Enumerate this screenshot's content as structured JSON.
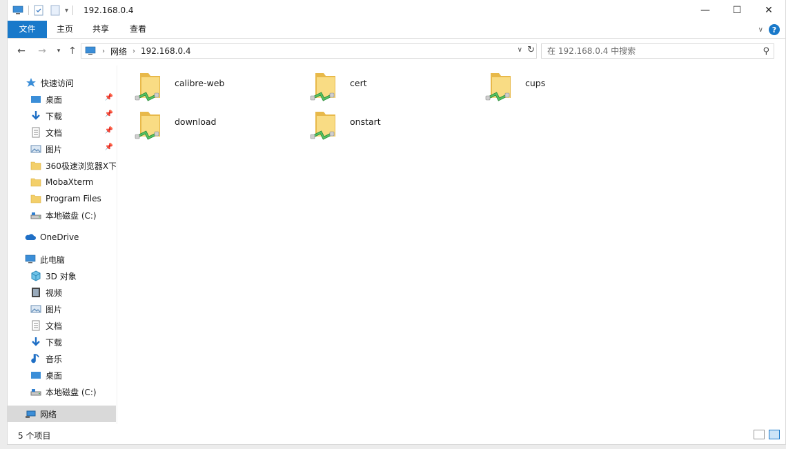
{
  "window": {
    "title": "192.168.0.4",
    "controls": {
      "minimize": "—",
      "maximize": "☐",
      "close": "✕"
    }
  },
  "ribbon": {
    "tabs": [
      {
        "label": "文件",
        "active": true
      },
      {
        "label": "主页"
      },
      {
        "label": "共享"
      },
      {
        "label": "查看"
      }
    ],
    "help_label": "?"
  },
  "address": {
    "crumbs": [
      "网络",
      "192.168.0.4"
    ]
  },
  "search": {
    "placeholder": "在 192.168.0.4 中搜索"
  },
  "navpane": {
    "items": [
      {
        "label": "快速访问",
        "icon": "star-icon"
      },
      {
        "label": "桌面",
        "icon": "desktop-icon",
        "pinned": true
      },
      {
        "label": "下载",
        "icon": "download-icon",
        "pinned": true
      },
      {
        "label": "文档",
        "icon": "document-icon",
        "pinned": true
      },
      {
        "label": "图片",
        "icon": "pictures-icon",
        "pinned": true
      },
      {
        "label": "360极速浏览器X下载",
        "icon": "folder-icon"
      },
      {
        "label": "MobaXterm",
        "icon": "folder-icon"
      },
      {
        "label": "Program Files",
        "icon": "folder-icon"
      },
      {
        "label": "本地磁盘 (C:)",
        "icon": "drive-icon"
      },
      {
        "label": "OneDrive",
        "icon": "cloud-icon"
      },
      {
        "label": "此电脑",
        "icon": "pc-icon"
      },
      {
        "label": "3D 对象",
        "icon": "cube-icon"
      },
      {
        "label": "视频",
        "icon": "video-icon"
      },
      {
        "label": "图片",
        "icon": "pictures-icon"
      },
      {
        "label": "文档",
        "icon": "document-icon"
      },
      {
        "label": "下载",
        "icon": "download-icon"
      },
      {
        "label": "音乐",
        "icon": "music-icon"
      },
      {
        "label": "桌面",
        "icon": "desktop-icon"
      },
      {
        "label": "本地磁盘 (C:)",
        "icon": "drive-icon"
      },
      {
        "label": "网络",
        "icon": "network-icon",
        "selected": true
      }
    ]
  },
  "content": {
    "items": [
      {
        "name": "calibre-web",
        "icon": "shared-folder-icon"
      },
      {
        "name": "cert",
        "icon": "shared-folder-icon"
      },
      {
        "name": "cups",
        "icon": "shared-folder-icon"
      },
      {
        "name": "download",
        "icon": "shared-folder-icon"
      },
      {
        "name": "onstart",
        "icon": "shared-folder-icon"
      }
    ]
  },
  "status": {
    "text": "5 个项目"
  },
  "colors": {
    "accent": "#1979ca",
    "folder": "#f3cf6a",
    "share_green": "#3aa84a",
    "selected_bg": "#d9d9d9"
  }
}
